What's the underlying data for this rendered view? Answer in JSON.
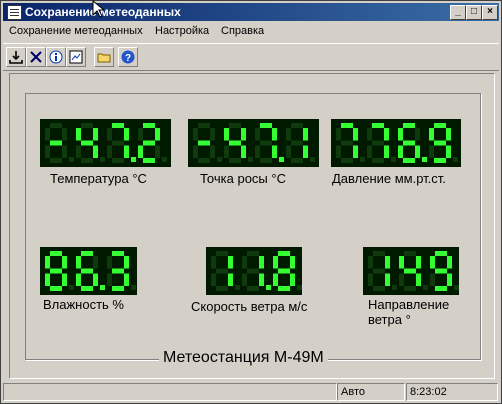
{
  "window": {
    "title": "Сохранение метеоданных",
    "minimize_glyph": "_",
    "maximize_glyph": "□",
    "close_glyph": "×"
  },
  "menu": {
    "items": [
      "Сохранение метеоданных",
      "Настройка",
      "Справка"
    ]
  },
  "toolbar": {
    "icons": [
      "download-icon",
      "close-icon",
      "info-icon",
      "chart-icon",
      "folder-icon",
      "help-icon"
    ]
  },
  "group": {
    "title": "Метеостанция М-49М"
  },
  "readings": {
    "temperature": {
      "value": "-47.2",
      "label": "Температура  °C"
    },
    "dew_point": {
      "value": "-47.1",
      "label": "Точка  росы  °C"
    },
    "pressure": {
      "value": "776.9",
      "label": "Давление мм.рт.ст."
    },
    "humidity": {
      "value": "86.3",
      "label": "Влажность %"
    },
    "wind_speed": {
      "value": "11.8",
      "label": "Скорость ветра м/с"
    },
    "wind_direction": {
      "value": "149",
      "label_line1": "Направление",
      "label_line2": "ветра °"
    }
  },
  "status": {
    "mode": "Авто",
    "time": "8:23:02"
  },
  "colors": {
    "segment_on": "#33ff33",
    "segment_off": "#0e3a0e",
    "lcd_bg": "#001a00"
  }
}
